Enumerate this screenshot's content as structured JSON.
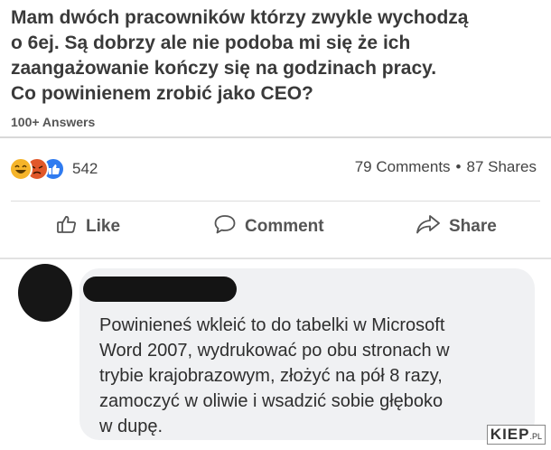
{
  "question": {
    "lines": [
      "Mam dwóch pracowników którzy zwykle wychodzą",
      "o 6ej. Są dobrzy ale nie podoba mi się że ich",
      "zaangażowanie kończy się na godzinach pracy.",
      "Co powinienem zrobić jako CEO?"
    ],
    "answers_label": "100+ Answers"
  },
  "reactions": {
    "icons": [
      "haha-icon",
      "angry-icon",
      "like-icon"
    ],
    "count": "542",
    "comments": "79 Comments",
    "separator": "•",
    "shares": "87 Shares"
  },
  "actions": {
    "like": "Like",
    "comment": "Comment",
    "share": "Share"
  },
  "comment": {
    "lines": [
      "Powinieneś wkleić to do tabelki w Microsoft",
      "Word 2007, wydrukować po obu stronach w",
      "trybie krajobrazowym, złożyć na pół 8 razy,",
      "zamoczyć w oliwie i wsadzić sobie głęboko",
      "w dupę."
    ]
  },
  "watermark": {
    "main": "KIEP",
    "suffix": ".PL"
  },
  "colors": {
    "haha": "#f5b429",
    "angry": "#e1582a",
    "like": "#2f7bf0",
    "bubble": "#f0f1f3",
    "redaction": "#141414"
  }
}
